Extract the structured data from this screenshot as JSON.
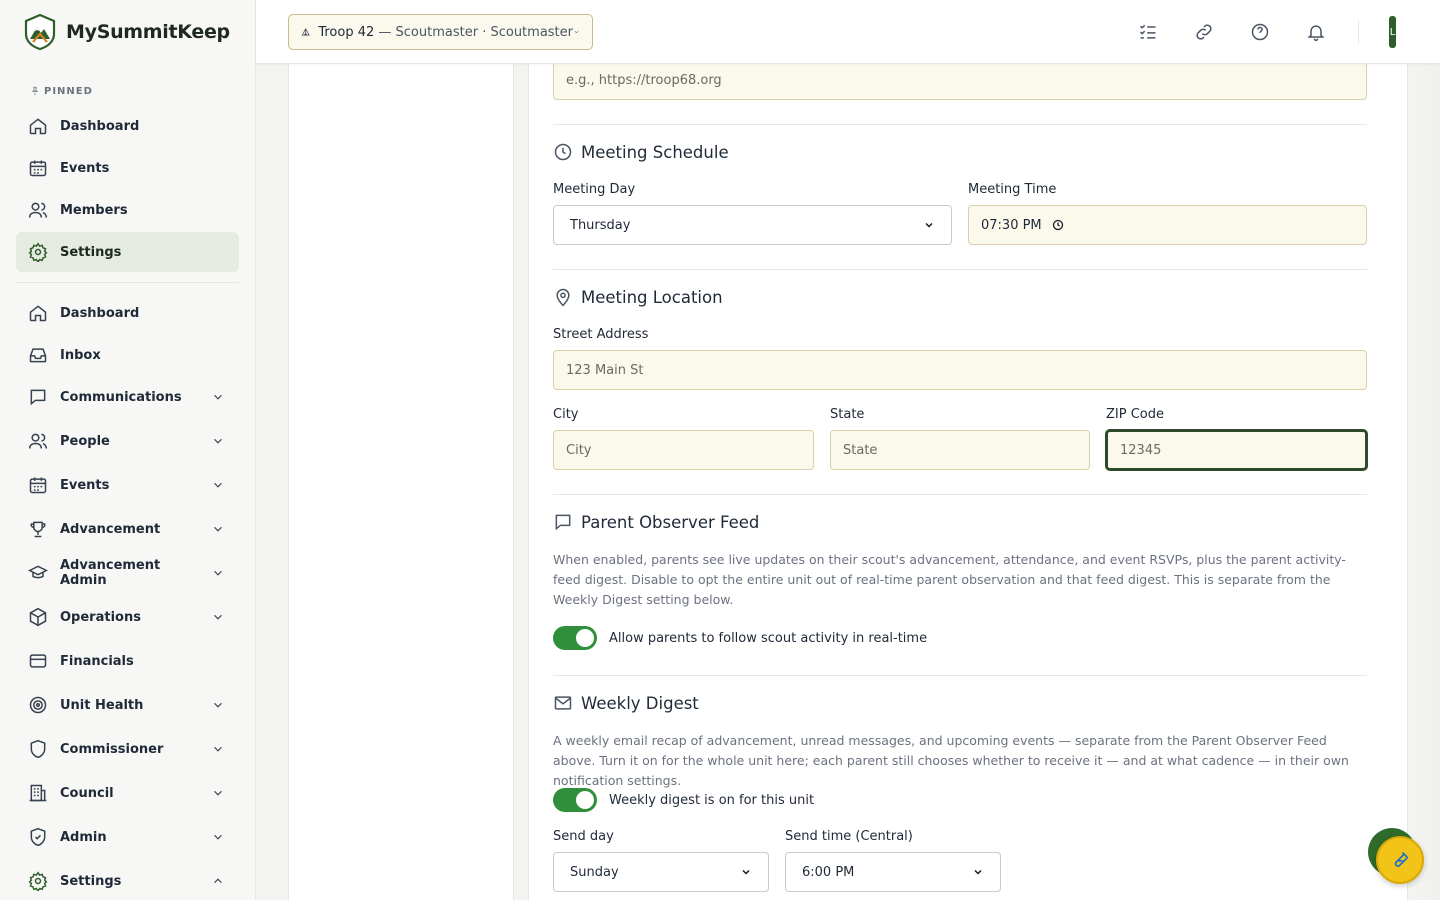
{
  "brand": {
    "name": "MySummitKeep"
  },
  "sidebar": {
    "pinned_label": "PINNED",
    "pinned": [
      {
        "label": "Dashboard",
        "icon": "home-icon"
      },
      {
        "label": "Events",
        "icon": "calendar-icon"
      },
      {
        "label": "Members",
        "icon": "users-icon"
      },
      {
        "label": "Settings",
        "icon": "gear-icon",
        "active": true
      }
    ],
    "main": [
      {
        "label": "Dashboard",
        "icon": "home-icon"
      },
      {
        "label": "Inbox",
        "icon": "inbox-icon"
      },
      {
        "label": "Communications",
        "icon": "chat-icon",
        "expandable": true
      },
      {
        "label": "People",
        "icon": "users-icon",
        "expandable": true
      },
      {
        "label": "Events",
        "icon": "calendar-icon",
        "expandable": true
      },
      {
        "label": "Advancement",
        "icon": "trophy-icon",
        "expandable": true
      },
      {
        "label": "Advancement Admin",
        "icon": "graduation-cap-icon",
        "expandable": true
      },
      {
        "label": "Operations",
        "icon": "package-icon",
        "expandable": true
      },
      {
        "label": "Financials",
        "icon": "credit-card-icon"
      },
      {
        "label": "Unit Health",
        "icon": "target-icon",
        "expandable": true
      },
      {
        "label": "Commissioner",
        "icon": "shield-icon",
        "expandable": true
      },
      {
        "label": "Council",
        "icon": "building-icon",
        "expandable": true
      },
      {
        "label": "Admin",
        "icon": "shield-check-icon",
        "expandable": true
      },
      {
        "label": "Settings",
        "icon": "gear-icon",
        "expandable": true,
        "expanded": true
      }
    ]
  },
  "topbar": {
    "unit_troop": "Troop 42",
    "unit_role": " — Scoutmaster · Scoutmaster",
    "avatar_initial": "L"
  },
  "form": {
    "website_placeholder": "e.g., https://troop68.org",
    "meeting_schedule": {
      "title": "Meeting Schedule",
      "day_label": "Meeting Day",
      "day_value": "Thursday",
      "time_label": "Meeting Time",
      "time_value": "07:30 PM"
    },
    "meeting_location": {
      "title": "Meeting Location",
      "street_label": "Street Address",
      "street_placeholder": "123 Main St",
      "city_label": "City",
      "city_placeholder": "City",
      "state_label": "State",
      "state_placeholder": "State",
      "zip_label": "ZIP Code",
      "zip_placeholder": "12345"
    },
    "parent_feed": {
      "title": "Parent Observer Feed",
      "description": "When enabled, parents see live updates on their scout's advancement, attendance, and event RSVPs, plus the parent activity-feed digest. Disable to opt the entire unit out of real-time parent observation and that feed digest. This is separate from the Weekly Digest setting below.",
      "toggle_label": "Allow parents to follow scout activity in real-time",
      "enabled": true
    },
    "weekly_digest": {
      "title": "Weekly Digest",
      "description": "A weekly email recap of advancement, unread messages, and upcoming events — separate from the Parent Observer Feed above. Turn it on for the whole unit here; each parent still chooses whether to receive it — and at what cadence — in their own notification settings.",
      "toggle_label": "Weekly digest is on for this unit",
      "enabled": true,
      "send_day_label": "Send day",
      "send_day_value": "Sunday",
      "send_time_label": "Send time (Central)",
      "send_time_value": "6:00 PM"
    }
  },
  "colors": {
    "brand_green": "#2f5d2b",
    "toggle_on": "#2f8f3a",
    "input_bg": "#fbf8ec",
    "fab": "#f2c417"
  }
}
